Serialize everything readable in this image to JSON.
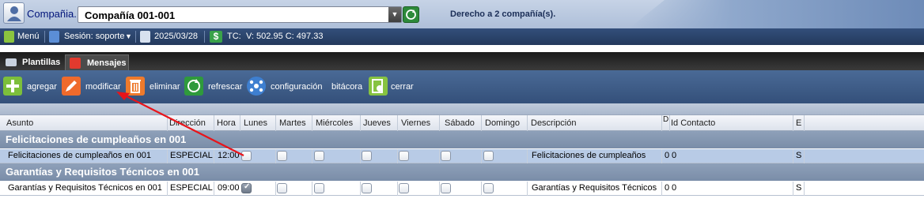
{
  "header": {
    "company_label": "Compañia.",
    "company_value": "Compañía 001-001",
    "rights_text": "Derecho a 2 compañía(s)."
  },
  "session_bar": {
    "menu": "Menú",
    "session": "Sesión: soporte",
    "date": "2025/03/28",
    "tc_label": "TC:",
    "tc_values": "V: 502.95 C: 497.33"
  },
  "tabs": [
    {
      "label": "Plantillas"
    },
    {
      "label": "Mensajes"
    }
  ],
  "toolbar": {
    "add": "agregar",
    "edit": "modificar",
    "delete": "eliminar",
    "refresh": "refrescar",
    "config": "configuración",
    "log": "bitácora",
    "close": "cerrar"
  },
  "grid": {
    "columns": [
      "Asunto",
      "Dirección",
      "Hora",
      "Lunes",
      "Martes",
      "Miércoles",
      "Jueves",
      "Viernes",
      "Sábado",
      "Domingo",
      "Descripción",
      "D",
      "Id Contacto",
      "E"
    ],
    "groups": [
      {
        "title": "Felicitaciones de cumpleaños en 001",
        "row": {
          "asunto": "Felicitaciones de cumpleaños en 001",
          "direccion": "ESPECIAL",
          "hora": "12:00",
          "lunes": false,
          "martes": false,
          "miercoles": false,
          "jueves": false,
          "viernes": false,
          "sabado": false,
          "domingo": false,
          "descripcion": "Felicitaciones de cumpleaños",
          "d": "0",
          "id_contacto": "0",
          "e": "S"
        }
      },
      {
        "title": "Garantías y Requisitos Técnicos en 001",
        "row": {
          "asunto": "Garantías y Requisitos Técnicos en 001",
          "direccion": "ESPECIAL",
          "hora": "09:00",
          "lunes": true,
          "martes": false,
          "miercoles": false,
          "jueves": false,
          "viernes": false,
          "sabado": false,
          "domingo": false,
          "descripcion": "Garantías y Requisitos Técnicos",
          "d": "0",
          "id_contacto": "0",
          "e": "S"
        }
      }
    ]
  },
  "colors": {
    "arrow": "#e8141a",
    "session_bar": "#2b4368",
    "toolbar": "#3f5d88",
    "group_row": "#8496b0",
    "selected_row": "#b8cbe6"
  }
}
